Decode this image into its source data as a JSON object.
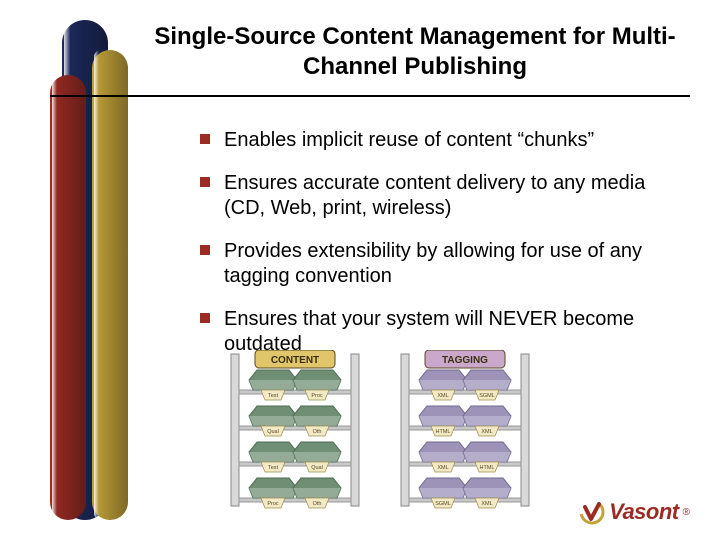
{
  "title": "Single-Source Content Management for Multi-Channel Publishing",
  "bullets": [
    "Enables implicit reuse of content “chunks”",
    "Ensures accurate content delivery to any media (CD, Web, print, wireless)",
    "Provides extensibility by allowing for use of any tagging convention",
    "Ensures that your system will NEVER become outdated"
  ],
  "illustrations": [
    {
      "header": "CONTENT",
      "header_bg": "#e0c56a",
      "tray_fill": "#6f8f75",
      "tray_stroke": "#4f6a55",
      "bins": [
        "Text",
        "Proc",
        "Qual",
        "Oth"
      ]
    },
    {
      "header": "TAGGING",
      "header_bg": "#c9a8cc",
      "tray_fill": "#9d93b8",
      "tray_stroke": "#6f6890",
      "bins": [
        "XML",
        "SGML",
        "HTML",
        "XML"
      ]
    }
  ],
  "logo": {
    "text": "Vasont",
    "reg": "®"
  },
  "colors": {
    "accent": "#9a2c24",
    "sidebar_navy": "#1d2a5c",
    "sidebar_gold": "#c2a23a"
  }
}
